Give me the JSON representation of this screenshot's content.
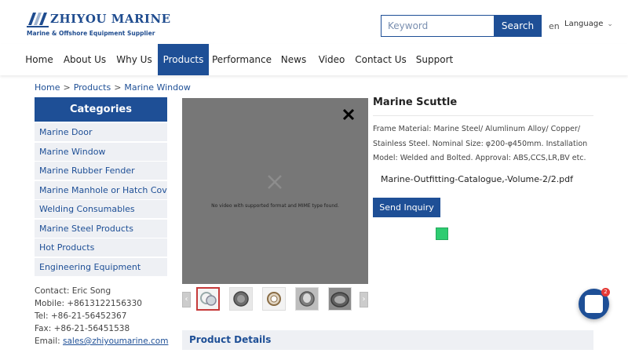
{
  "brand": {
    "name": "ZHIYOU MARINE",
    "tagline": "Marine & Offshore Equipment Supplier",
    "logo_icon": "ship-logo-icon"
  },
  "search": {
    "placeholder": "Keyword",
    "button_label": "Search"
  },
  "language": {
    "code": "en",
    "label": "Language"
  },
  "nav": {
    "items": [
      {
        "label": "Home"
      },
      {
        "label": "About Us"
      },
      {
        "label": "Why Us"
      },
      {
        "label": "Products",
        "active": true
      },
      {
        "label": "Performance"
      },
      {
        "label": "News"
      },
      {
        "label": "Video"
      },
      {
        "label": "Contact Us"
      },
      {
        "label": "Support"
      }
    ]
  },
  "breadcrumb": {
    "items": [
      "Home",
      "Products",
      "Marine Window"
    ],
    "separator": ">"
  },
  "sidebar": {
    "title": "Categories",
    "items": [
      "Marine Door",
      "Marine Window",
      "Marine Rubber Fender",
      "Marine Manhole or Hatch Cover",
      "Welding Consumables",
      "Marine Steel Products",
      "Hot Products",
      "Engineering Equipment"
    ]
  },
  "contact": {
    "person": "Contact: Eric Song",
    "mobile": "Mobile: +8613122156330",
    "tel": "Tel: +86-21-56452367",
    "fax": "Fax: +86-21-56451538",
    "email_label": "Email: ",
    "email": "sales@zhiyoumarine.com"
  },
  "video": {
    "message": "No video with supported format and MIME type found."
  },
  "product": {
    "title": "Marine Scuttle",
    "description": "Frame Material: Marine Steel/ Alumlinum Alloy/ Copper/ Stainless Steel. Nominal Size: φ200-φ450mm. Installation Model: Welded and Bolted. Approval: ABS,CCS,LR,BV etc.",
    "pdf": "Marine-Outfitting-Catalogue,-Volume-2/2.pdf",
    "inquiry_label": "Send Inquiry"
  },
  "details": {
    "title": "Product Details"
  },
  "chat": {
    "badge": "2"
  },
  "colors": {
    "primary": "#1e4f96",
    "accent_red": "#c63a3a",
    "green": "#2ecc71",
    "badge": "#e53935"
  }
}
